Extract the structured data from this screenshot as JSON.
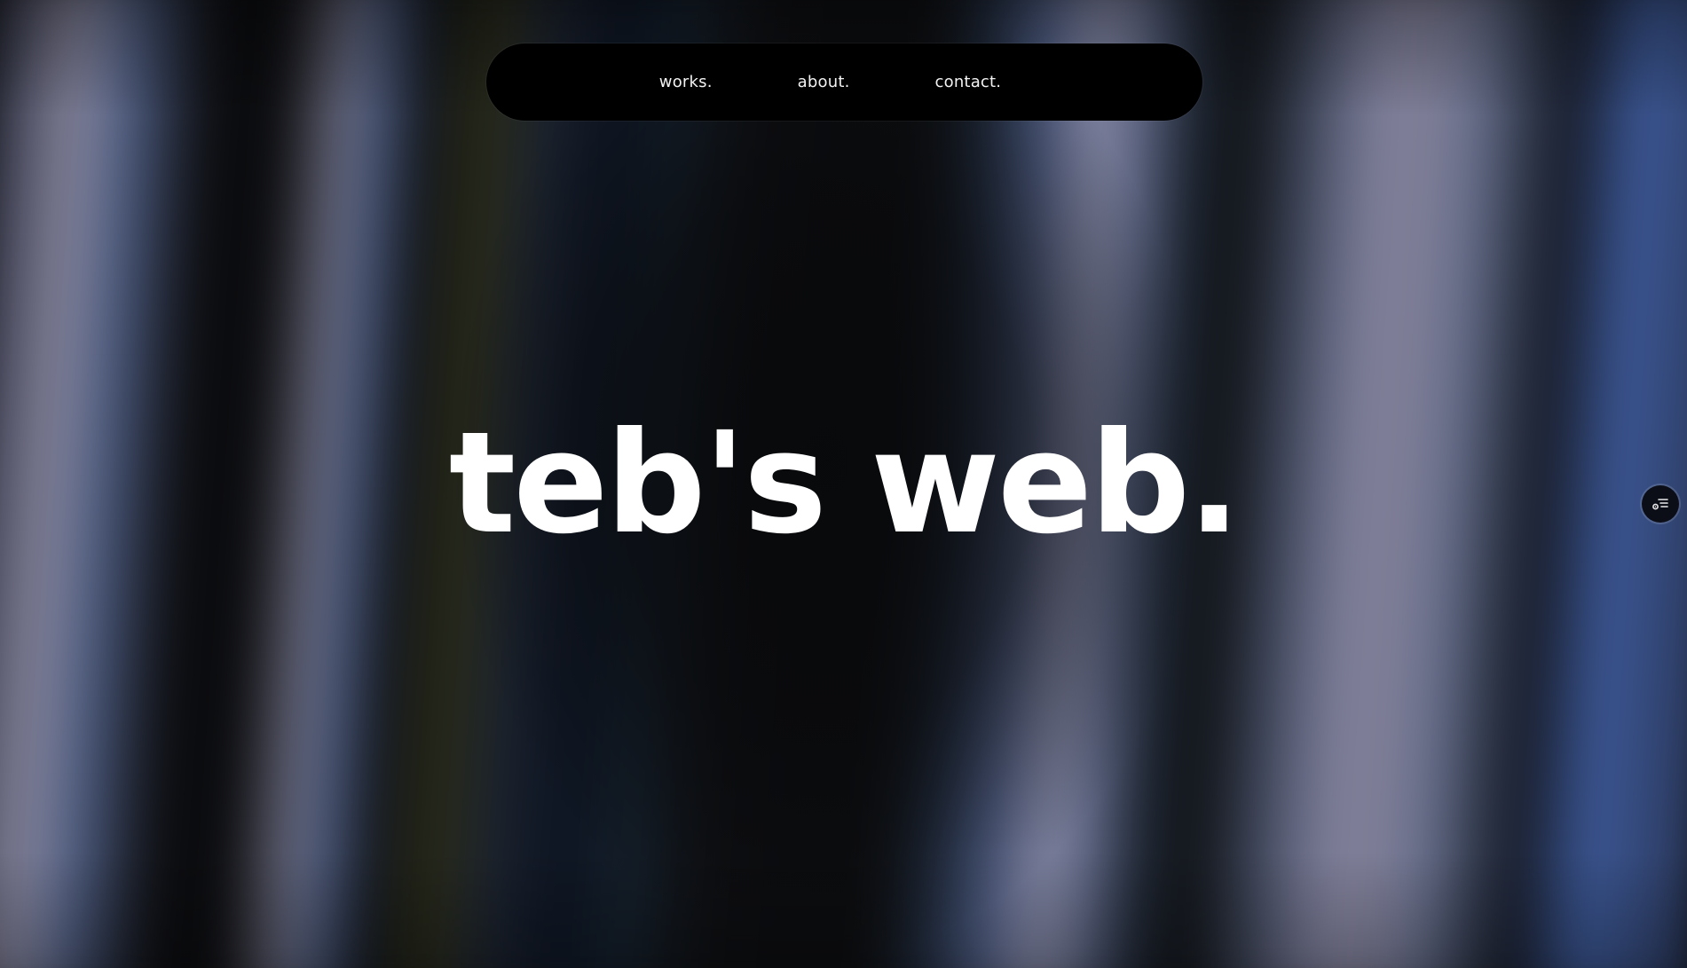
{
  "nav": {
    "items": [
      {
        "label": "works."
      },
      {
        "label": "about."
      },
      {
        "label": "contact."
      }
    ]
  },
  "hero": {
    "title": "teb's web."
  },
  "side_widget": {
    "icon": "settings-list-icon"
  },
  "colors": {
    "navbar_background": "#000000",
    "text": "#ffffff",
    "page_background": "#0c0d10"
  }
}
